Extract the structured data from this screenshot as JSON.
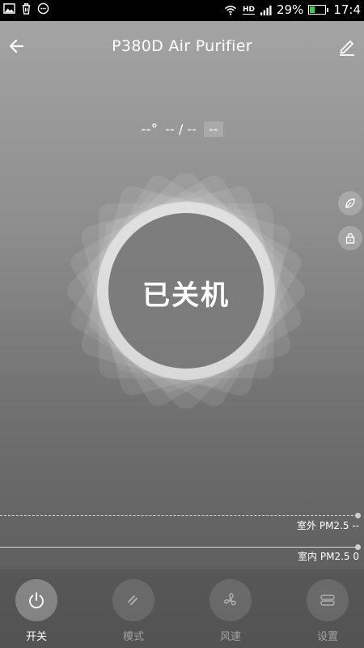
{
  "status_bar": {
    "battery_percent": "29%",
    "battery_level": 0.29,
    "time": "17:4",
    "network_label": "HD",
    "left_icons": [
      "image-icon",
      "trash-icon",
      "chat-icon"
    ],
    "right_icons": [
      "wifi-icon",
      "signal-icon",
      "battery-icon"
    ]
  },
  "header": {
    "title": "P380D Air Purifier"
  },
  "readings": {
    "temp": "--°",
    "humidity": "-- / --",
    "extra": "--"
  },
  "device": {
    "power_state": "已关机"
  },
  "side_buttons": {
    "top_icon": "leaf-icon",
    "bottom_icon": "lock-icon"
  },
  "pm": {
    "outdoor_label": "室外 PM2.5 --",
    "indoor_label": "室内 PM2.5 0"
  },
  "tabs": [
    {
      "label": "开关",
      "icon": "power-icon",
      "active": true
    },
    {
      "label": "模式",
      "icon": "mode-icon",
      "active": false
    },
    {
      "label": "风速",
      "icon": "fan-icon",
      "active": false
    },
    {
      "label": "设置",
      "icon": "settings-icon",
      "active": false
    }
  ],
  "colors": {
    "battery_fill": "#2fd14a",
    "background_top": "#a6a6a6",
    "background_bottom": "#575757"
  }
}
